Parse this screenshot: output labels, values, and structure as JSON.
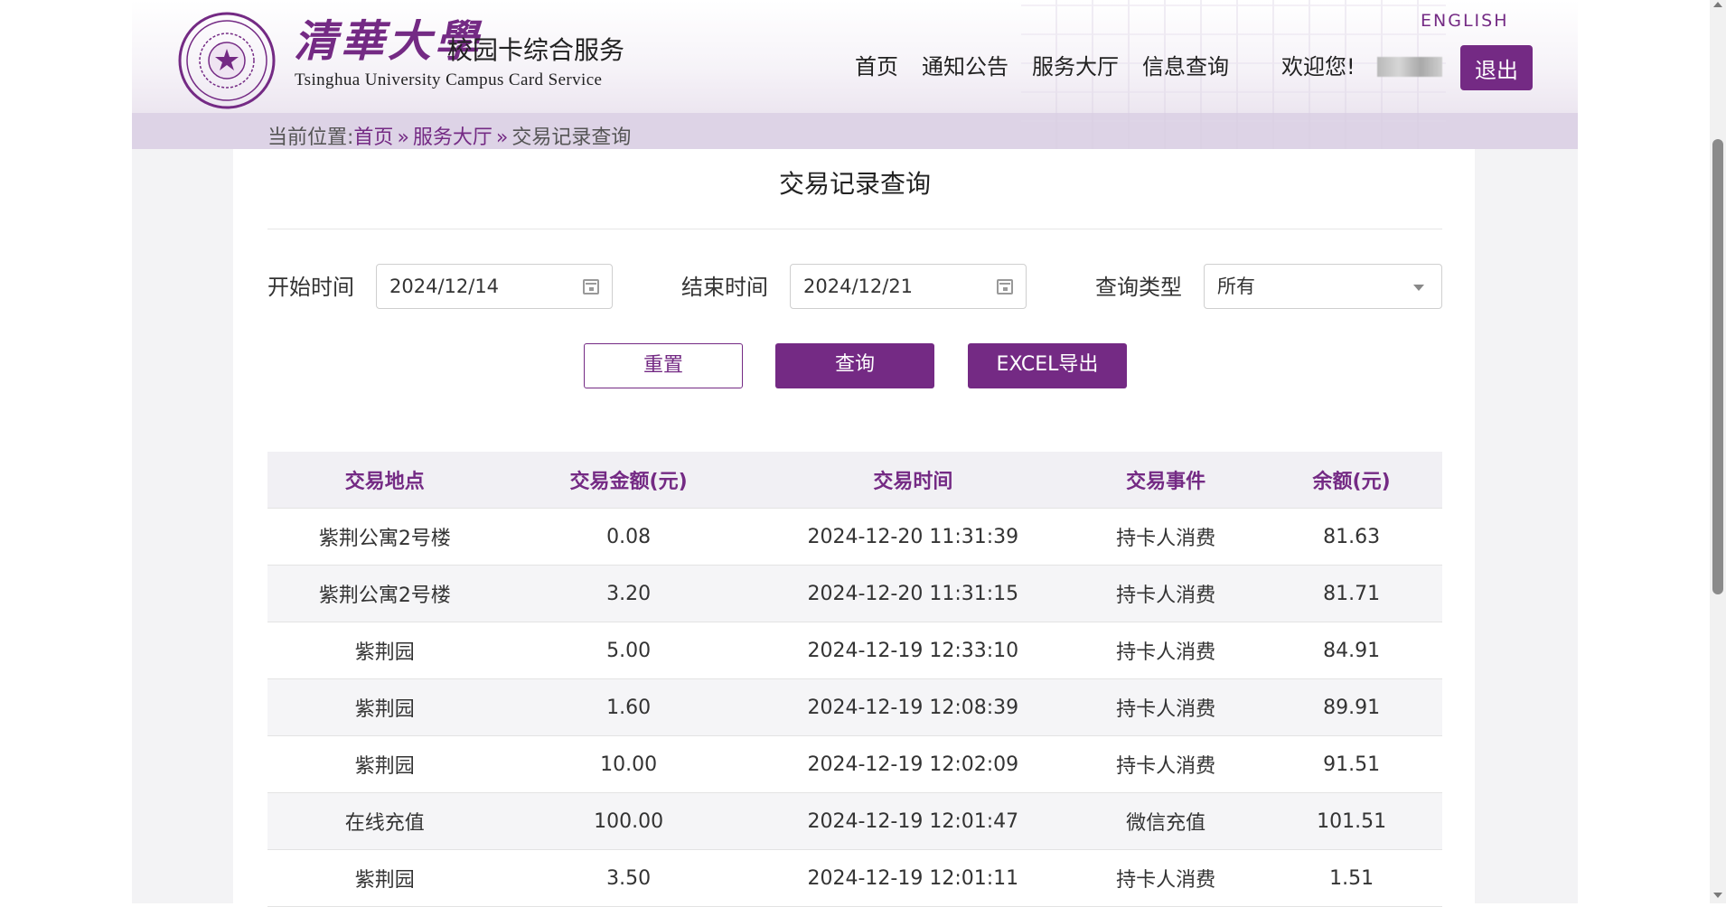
{
  "header": {
    "logo_title": "清華大學",
    "logo_subtitle": "校园卡综合服务",
    "logo_english": "Tsinghua University Campus Card Service",
    "language_link": "ENGLISH",
    "nav": [
      "首页",
      "通知公告",
      "服务大厅",
      "信息查询"
    ],
    "welcome": "欢迎您!",
    "logout": "退出"
  },
  "breadcrumb": {
    "prefix": "当前位置:",
    "items": [
      "首页",
      "服务大厅",
      "交易记录查询"
    ],
    "separator": "»"
  },
  "page_title": "交易记录查询",
  "filters": {
    "start_label": "开始时间",
    "start_value": "2024/12/14",
    "end_label": "结束时间",
    "end_value": "2024/12/21",
    "type_label": "查询类型",
    "type_value": "所有"
  },
  "buttons": {
    "reset": "重置",
    "query": "查询",
    "export": "EXCEL导出"
  },
  "table": {
    "headers": [
      "交易地点",
      "交易金额(元)",
      "交易时间",
      "交易事件",
      "余额(元)"
    ],
    "rows": [
      [
        "紫荆公寓2号楼",
        "0.08",
        "2024-12-20 11:31:39",
        "持卡人消费",
        "81.63"
      ],
      [
        "紫荆公寓2号楼",
        "3.20",
        "2024-12-20 11:31:15",
        "持卡人消费",
        "81.71"
      ],
      [
        "紫荆园",
        "5.00",
        "2024-12-19 12:33:10",
        "持卡人消费",
        "84.91"
      ],
      [
        "紫荆园",
        "1.60",
        "2024-12-19 12:08:39",
        "持卡人消费",
        "89.91"
      ],
      [
        "紫荆园",
        "10.00",
        "2024-12-19 12:02:09",
        "持卡人消费",
        "91.51"
      ],
      [
        "在线充值",
        "100.00",
        "2024-12-19 12:01:47",
        "微信充值",
        "101.51"
      ],
      [
        "紫荆园",
        "3.50",
        "2024-12-19 12:01:11",
        "持卡人消费",
        "1.51"
      ]
    ]
  },
  "colors": {
    "brand": "#742a84",
    "header_band": "#ddd3e6",
    "table_header_bg": "#f1f0f4",
    "row_alt_bg": "#f5f5f7"
  },
  "icons": {
    "logo": "tsinghua-seal-icon",
    "calendar": "calendar-icon",
    "dropdown": "chevron-down-icon"
  }
}
